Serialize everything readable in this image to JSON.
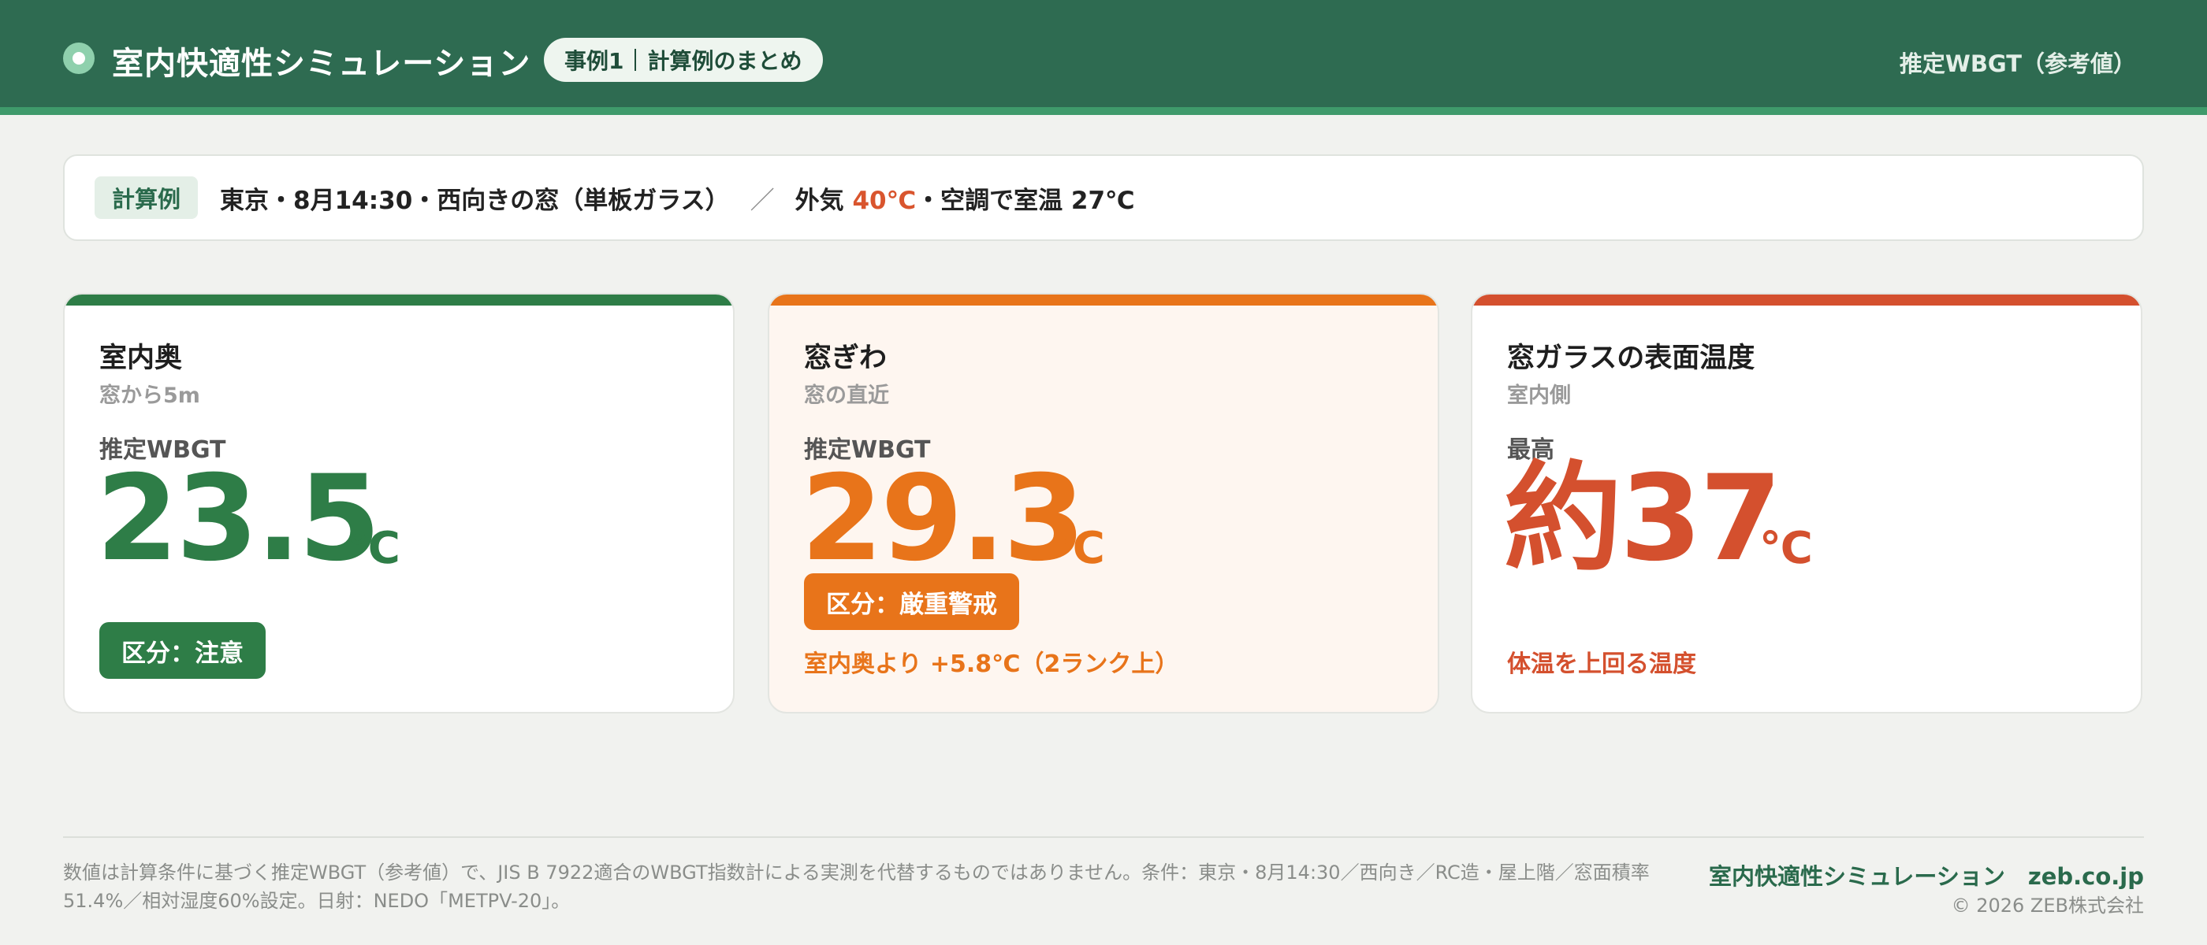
{
  "header": {
    "title": "室内快適性シミュレーション",
    "pill_case": "事例1",
    "pill_text": "計算例のまとめ",
    "right_label": "推定WBGT（参考値）",
    "colors": {
      "bar": "#2e6b51",
      "accent_line": "#3f9a6b"
    }
  },
  "condition": {
    "tag": "計算例",
    "text_part1": "東京・8月14:30・西向きの窓（単板ガラス）",
    "slash": "／",
    "text_part2": "外気 ",
    "outside_temp": "40℃",
    "text_part3": "・空調で室温 27℃"
  },
  "cards": [
    {
      "title": "室内奥",
      "subtitle": "窓から5m",
      "metric_label": "推定WBGT",
      "value": "23.5",
      "unit": "℃",
      "badge": "区分：注意",
      "note": "",
      "color": "#2e7d47",
      "bg": "#ffffff"
    },
    {
      "title": "窓ぎわ",
      "subtitle": "窓の直近",
      "metric_label": "推定WBGT",
      "value": "29.3",
      "unit": "℃",
      "badge": "区分：厳重警戒",
      "note": "室内奥より +5.8℃（2ランク上）",
      "color": "#e8741a",
      "bg": "#fef6f0"
    },
    {
      "title": "窓ガラスの表面温度",
      "subtitle": "室内側",
      "metric_label": "最高",
      "value": "約37",
      "unit": "℃",
      "badge": "",
      "note": "体温を上回る温度",
      "color": "#d4502e",
      "bg": "#ffffff"
    }
  ],
  "footer": {
    "disclaimer": "数値は計算条件に基づく推定WBGT（参考値）で、JIS B 7922適合のWBGT指数計による実測を代替するものではありません。条件：東京・8月14:30／西向き／RC造・屋上階／窓面積率51.4%／相対湿度60%設定。日射：NEDO「METPV-20」。",
    "brand": "室内快適性シミュレーション　zeb.co.jp",
    "copyright": "© 2026 ZEB株式会社"
  }
}
